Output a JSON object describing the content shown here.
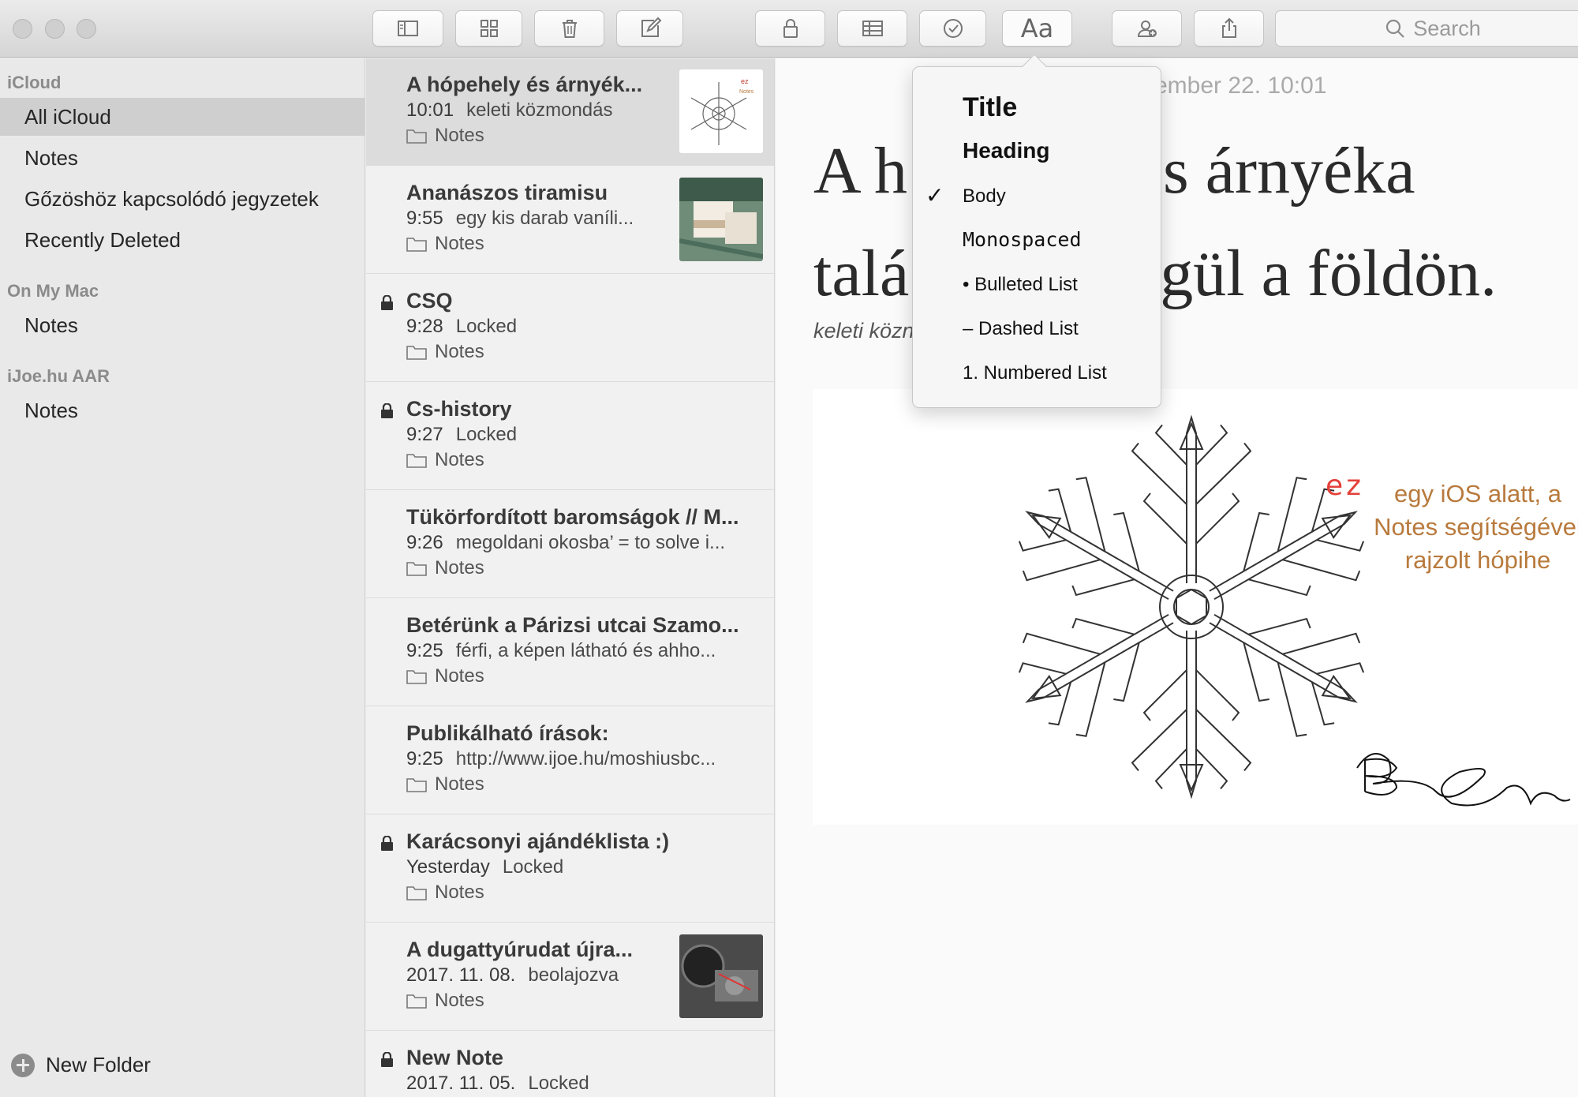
{
  "toolbar": {
    "search_placeholder": "Search",
    "format_button_label": "Aa",
    "buttons": [
      "sidebar-toggle-icon",
      "gallery-icon",
      "trash-icon",
      "compose-icon",
      "lock-icon",
      "table-icon",
      "checklist-icon",
      "format-icon",
      "add-people-icon",
      "share-icon"
    ]
  },
  "sidebar": {
    "sections": [
      {
        "header": "iCloud",
        "items": [
          "All iCloud",
          "Notes",
          "Gőzöshöz kapcsolódó jegyzetek",
          "Recently Deleted"
        ]
      },
      {
        "header": "On My Mac",
        "items": [
          "Notes"
        ]
      },
      {
        "header": "iJoe.hu AAR",
        "items": [
          "Notes"
        ]
      }
    ],
    "selected": "All iCloud",
    "new_folder_label": "New Folder"
  },
  "notes": [
    {
      "title": "A hópehely és árnyék...",
      "time": "10:01",
      "preview": "keleti közmondás",
      "folder": "Notes",
      "locked": false,
      "thumb": "snowflake",
      "selected": true
    },
    {
      "title": "Ananászos tiramisu",
      "time": "9:55",
      "preview": "egy kis darab vaníli...",
      "folder": "Notes",
      "locked": false,
      "thumb": "cake",
      "selected": false
    },
    {
      "title": "CSQ",
      "time": "9:28",
      "preview": "Locked",
      "folder": "Notes",
      "locked": true,
      "thumb": null,
      "selected": false
    },
    {
      "title": "Cs-history",
      "time": "9:27",
      "preview": "Locked",
      "folder": "Notes",
      "locked": true,
      "thumb": null,
      "selected": false
    },
    {
      "title": "Tükörfordított baromságok // M...",
      "time": "9:26",
      "preview": "megoldani okosba’ = to solve i...",
      "folder": "Notes",
      "locked": false,
      "thumb": null,
      "selected": false
    },
    {
      "title": "Betérünk a Párizsi utcai Szamo...",
      "time": "9:25",
      "preview": "férfi, a képen látható és ahho...",
      "folder": "Notes",
      "locked": false,
      "thumb": null,
      "selected": false
    },
    {
      "title": "Publikálható írások:",
      "time": "9:25",
      "preview": "http://www.ijoe.hu/moshiusbc...",
      "folder": "Notes",
      "locked": false,
      "thumb": null,
      "selected": false
    },
    {
      "title": "Karácsonyi ajándéklista :)",
      "time": "Yesterday",
      "preview": "Locked",
      "folder": "Notes",
      "locked": true,
      "thumb": null,
      "selected": false
    },
    {
      "title": "A dugattyúrudat újra...",
      "time": "2017. 11. 08.",
      "preview": "beolajozva",
      "folder": "Notes",
      "locked": false,
      "thumb": "engine",
      "selected": false
    },
    {
      "title": "New Note",
      "time": "2017. 11. 05.",
      "preview": "Locked",
      "folder": "Notes",
      "locked": true,
      "thumb": null,
      "selected": false
    }
  ],
  "editor": {
    "date_visible": "ember 22. 10:01",
    "title_line1_left": "A h",
    "title_line1_right": "s árnyéka",
    "title_line2_left": "talá",
    "title_line2_right": "gül a földön.",
    "subtitle_visible": "keleti közn",
    "drawing": {
      "annotation_red": "ez",
      "annotation": [
        "egy iOS alatt, a",
        "Notes segítségével",
        "rajzolt hópihe"
      ]
    }
  },
  "format_popover": {
    "items": [
      "Title",
      "Heading",
      "Body",
      "Monospaced",
      "• Bulleted List",
      "– Dashed List",
      "1. Numbered List"
    ],
    "checked": "Body",
    "check_glyph": "✓"
  }
}
